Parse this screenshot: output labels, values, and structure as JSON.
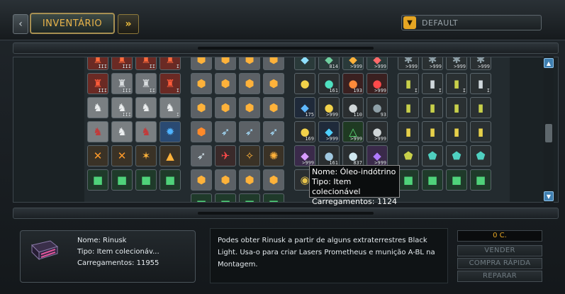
{
  "header": {
    "inventory_tab": "INVENTÁRIO",
    "nav_prev": "‹",
    "nav_next": "»",
    "filter": {
      "value": "DEFAULT"
    }
  },
  "grid": {
    "columns": [
      {
        "rows": [
          [
            {
              "icon": "red-drone-icon",
              "bg": "#6a2a24",
              "fg": "#ff6a3c",
              "qty": "III"
            },
            {
              "icon": "red-drone-icon",
              "bg": "#6a2a24",
              "fg": "#ff6a3c",
              "qty": "III"
            },
            {
              "icon": "red-drone-icon",
              "bg": "#6a2a24",
              "fg": "#ff6a3c",
              "qty": "II"
            },
            {
              "icon": "red-drone-icon",
              "bg": "#6a2a24",
              "fg": "#ff6a3c",
              "qty": "I"
            }
          ],
          [
            {
              "icon": "red-drone-icon",
              "bg": "#6a2a24",
              "fg": "#ff5b3a",
              "qty": "III"
            },
            {
              "icon": "grey-drone-icon",
              "bg": "#6f7478",
              "fg": "#d8dcde",
              "qty": "III"
            },
            {
              "icon": "grey-drone-icon",
              "bg": "#6f7478",
              "fg": "#d8dcde",
              "qty": "II"
            },
            {
              "icon": "red-drone-icon",
              "bg": "#6a2a24",
              "fg": "#ff5b3a",
              "qty": "I"
            }
          ],
          [
            {
              "icon": "grey-mech-icon",
              "bg": "#7a7f82",
              "fg": "#eceff0",
              "qty": ""
            },
            {
              "icon": "grey-mech-icon",
              "bg": "#7a7f82",
              "fg": "#eceff0",
              "qty": "III"
            },
            {
              "icon": "grey-mech-icon",
              "bg": "#7a7f82",
              "fg": "#eceff0",
              "qty": ""
            },
            {
              "icon": "grey-mech-icon",
              "bg": "#7a7f82",
              "fg": "#eceff0",
              "qty": "I"
            }
          ],
          [
            {
              "icon": "red-mech-icon",
              "bg": "#7a7f82",
              "fg": "#c23a3a",
              "qty": ""
            },
            {
              "icon": "grey-mech-icon",
              "bg": "#7a7f82",
              "fg": "#eceff0",
              "qty": ""
            },
            {
              "icon": "red-mech-icon",
              "bg": "#7a7f82",
              "fg": "#c23a3a",
              "qty": ""
            },
            {
              "icon": "blue-gear-icon",
              "bg": "#2a4a72",
              "fg": "#4fb3ff",
              "qty": ""
            }
          ],
          [
            {
              "icon": "orange-tool-icon",
              "bg": "#3a3226",
              "fg": "#ff9a2a",
              "qty": ""
            },
            {
              "icon": "orange-tool-icon",
              "bg": "#3a3226",
              "fg": "#ff9a2a",
              "qty": ""
            },
            {
              "icon": "orange-star-icon",
              "bg": "#3a3226",
              "fg": "#ffb23a",
              "qty": ""
            },
            {
              "icon": "orange-triangle-icon",
              "bg": "#3a3226",
              "fg": "#ffb23a",
              "qty": ""
            }
          ],
          [
            {
              "icon": "green-module-icon",
              "bg": "#1f3a2a",
              "fg": "#4fd27a",
              "qty": ""
            },
            {
              "icon": "green-module-icon",
              "bg": "#1f3a2a",
              "fg": "#4fd27a",
              "qty": ""
            },
            {
              "icon": "green-module-icon",
              "bg": "#1f3a2a",
              "fg": "#4fd27a",
              "qty": ""
            },
            {
              "icon": "green-module-icon",
              "bg": "#1f3a2a",
              "fg": "#4fd27a",
              "qty": ""
            }
          ]
        ]
      },
      {
        "rows": [
          [
            {
              "icon": "orange-hex-icon",
              "bg": "#5c6166",
              "fg": "#ffb23a",
              "qty": ""
            },
            {
              "icon": "orange-hex-icon",
              "bg": "#5c6166",
              "fg": "#ffb23a",
              "qty": ""
            },
            {
              "icon": "orange-hex-icon",
              "bg": "#5c6166",
              "fg": "#ffb23a",
              "qty": ""
            },
            {
              "icon": "orange-hex-icon",
              "bg": "#5c6166",
              "fg": "#ffb23a",
              "qty": ""
            }
          ],
          [
            {
              "icon": "orange-hex-icon",
              "bg": "#5c6166",
              "fg": "#ffb23a",
              "qty": ""
            },
            {
              "icon": "orange-hex-icon",
              "bg": "#5c6166",
              "fg": "#ffb23a",
              "qty": ""
            },
            {
              "icon": "orange-hex-icon",
              "bg": "#5c6166",
              "fg": "#ffb23a",
              "qty": ""
            },
            {
              "icon": "orange-hex-icon",
              "bg": "#5c6166",
              "fg": "#ffb23a",
              "qty": ""
            }
          ],
          [
            {
              "icon": "orange-hex-icon",
              "bg": "#5c6166",
              "fg": "#ffb23a",
              "qty": ""
            },
            {
              "icon": "orange-hex-icon",
              "bg": "#5c6166",
              "fg": "#ffb23a",
              "qty": ""
            },
            {
              "icon": "orange-hex-icon",
              "bg": "#5c6166",
              "fg": "#ffb23a",
              "qty": ""
            },
            {
              "icon": "orange-hex-icon",
              "bg": "#5c6166",
              "fg": "#ffb23a",
              "qty": ""
            }
          ],
          [
            {
              "icon": "orange-hex-icon",
              "bg": "#5c6166",
              "fg": "#ff8a2a",
              "qty": ""
            },
            {
              "icon": "missile-icon",
              "bg": "#5c6166",
              "fg": "#a7e0ff",
              "qty": ""
            },
            {
              "icon": "missile-icon",
              "bg": "#5c6166",
              "fg": "#a7e0ff",
              "qty": ""
            },
            {
              "icon": "missile-icon",
              "bg": "#5c6166",
              "fg": "#a7e0ff",
              "qty": ""
            }
          ],
          [
            {
              "icon": "missile-icon",
              "bg": "#5c6166",
              "fg": "#d7e8f0",
              "qty": ""
            },
            {
              "icon": "red-ship-icon",
              "bg": "#3a2a2a",
              "fg": "#ff4a4a",
              "qty": ""
            },
            {
              "icon": "wrench-icon",
              "bg": "#3a3226",
              "fg": "#ffb23a",
              "qty": ""
            },
            {
              "icon": "cog-icon",
              "bg": "#3a3226",
              "fg": "#ffb23a",
              "qty": ""
            }
          ],
          [
            {
              "icon": "orange-hex-icon",
              "bg": "#5c6166",
              "fg": "#ffb23a",
              "qty": ""
            },
            {
              "icon": "orange-hex-icon",
              "bg": "#5c6166",
              "fg": "#ffb23a",
              "qty": ""
            },
            {
              "icon": "orange-hex-icon",
              "bg": "#5c6166",
              "fg": "#ffb23a",
              "qty": ""
            },
            {
              "icon": "orange-hex-icon",
              "bg": "#5c6166",
              "fg": "#ffb23a",
              "qty": ""
            }
          ],
          [
            {
              "icon": "green-module-icon",
              "bg": "#1f3a2a",
              "fg": "#4fd27a",
              "qty": ""
            },
            {
              "icon": "green-module-icon",
              "bg": "#1f3a2a",
              "fg": "#4fd27a",
              "qty": ""
            },
            {
              "icon": "green-module-icon",
              "bg": "#1f3a2a",
              "fg": "#4fd27a",
              "qty": ""
            },
            {
              "icon": "green-module-icon",
              "bg": "#1f3a2a",
              "fg": "#4fd27a",
              "qty": ""
            }
          ]
        ]
      },
      {
        "rows": [
          [
            {
              "icon": "crystal-icon",
              "bg": "#2a3a3a",
              "fg": "#8fe0ff",
              "qty": ""
            },
            {
              "icon": "crystal-icon",
              "bg": "#2a3a3a",
              "fg": "#6fd0a0",
              "qty": "814"
            },
            {
              "icon": "crystal-icon",
              "bg": "#2a3a3a",
              "fg": "#ffb23a",
              "qty": ">999"
            },
            {
              "icon": "crystal-icon",
              "bg": "#2a3a3a",
              "fg": "#ff6a6a",
              "qty": ">999"
            }
          ],
          [
            {
              "icon": "ore-icon",
              "bg": "#2a2e30",
              "fg": "#f2d24a",
              "qty": ""
            },
            {
              "icon": "ore-icon",
              "bg": "#2a2e30",
              "fg": "#4fe0c0",
              "qty": "161"
            },
            {
              "icon": "ore-icon",
              "bg": "#3a2020",
              "fg": "#ff8a3a",
              "qty": "193"
            },
            {
              "icon": "ore-icon",
              "bg": "#3a2020",
              "fg": "#ff4a4a",
              "qty": ">999"
            }
          ],
          [
            {
              "icon": "crystal-icon",
              "bg": "#1f2a3a",
              "fg": "#5fb8ff",
              "qty": "175"
            },
            {
              "icon": "ore-icon",
              "bg": "#2a2e30",
              "fg": "#f2d24a",
              "qty": ">999"
            },
            {
              "icon": "ore-icon",
              "bg": "#2a2e30",
              "fg": "#d0d6d8",
              "qty": "110"
            },
            {
              "icon": "ore-icon",
              "bg": "#2a2e30",
              "fg": "#8fa0a8",
              "qty": "93"
            }
          ],
          [
            {
              "icon": "ore-icon",
              "bg": "#2a2e30",
              "fg": "#f2d24a",
              "qty": "169"
            },
            {
              "icon": "crystal-icon",
              "bg": "#1f2a3a",
              "fg": "#4fd0ff",
              "qty": ">999"
            },
            {
              "icon": "triangle-icon",
              "bg": "#1f3a22",
              "fg": "#5fe07a",
              "qty": ">999"
            },
            {
              "icon": "ore-icon",
              "bg": "#2a2e30",
              "fg": "#d0d6d8",
              "qty": ">999"
            }
          ],
          [
            {
              "icon": "crystal-icon",
              "bg": "#3a2a4a",
              "fg": "#d79aff",
              "qty": ">999"
            },
            {
              "icon": "ore-icon",
              "bg": "#2a2e30",
              "fg": "#a0c8e0",
              "qty": "161"
            },
            {
              "icon": "ore-icon",
              "bg": "#2a2e30",
              "fg": "#d0e8f0",
              "qty": "837"
            },
            {
              "icon": "crystal-icon",
              "bg": "#3a2a4a",
              "fg": "#b07aff",
              "qty": ">999"
            }
          ],
          [
            {
              "icon": "coin-icon",
              "bg": "#2a2e30",
              "fg": "#e6c24a",
              "qty": ""
            },
            {
              "icon": "coin-icon",
              "bg": "#2a2e30",
              "fg": "#e6c24a",
              "qty": ""
            },
            {
              "icon": "coin-icon",
              "bg": "#2a2e30",
              "fg": "#e6c24a",
              "qty": ""
            },
            {
              "icon": "coin-icon",
              "bg": "#2a2e30",
              "fg": "#e6c24a",
              "qty": ""
            }
          ]
        ]
      },
      {
        "rows": [
          [
            {
              "icon": "gear-module-icon",
              "bg": "#2a3032",
              "fg": "#8fa0a8",
              "qty": ">999"
            },
            {
              "icon": "gear-module-icon",
              "bg": "#2a3032",
              "fg": "#8fa0a8",
              "qty": ">999"
            },
            {
              "icon": "gear-module-icon",
              "bg": "#2a3032",
              "fg": "#8fa0a8",
              "qty": ">999"
            },
            {
              "icon": "gear-module-icon",
              "bg": "#2a3032",
              "fg": "#8fa0a8",
              "qty": ">999"
            }
          ],
          [
            {
              "icon": "cannon-icon",
              "bg": "#2a3032",
              "fg": "#c8d04a",
              "qty": "I"
            },
            {
              "icon": "cannon-icon",
              "bg": "#2a3032",
              "fg": "#d0d8dc",
              "qty": "I"
            },
            {
              "icon": "cannon-icon",
              "bg": "#2a3032",
              "fg": "#c8d04a",
              "qty": "I"
            },
            {
              "icon": "cannon-icon",
              "bg": "#2a3032",
              "fg": "#d0d8dc",
              "qty": "I"
            }
          ],
          [
            {
              "icon": "cannon-icon",
              "bg": "#2a3032",
              "fg": "#c8d04a",
              "qty": ""
            },
            {
              "icon": "cannon-icon",
              "bg": "#2a3032",
              "fg": "#c8d04a",
              "qty": ""
            },
            {
              "icon": "cannon-icon",
              "bg": "#2a3032",
              "fg": "#c8d04a",
              "qty": ""
            },
            {
              "icon": "cannon-icon",
              "bg": "#2a3032",
              "fg": "#c8d04a",
              "qty": ""
            }
          ],
          [
            {
              "icon": "cannon-icon",
              "bg": "#2a3032",
              "fg": "#e6d04a",
              "qty": ""
            },
            {
              "icon": "cannon-icon",
              "bg": "#2a3032",
              "fg": "#e6d04a",
              "qty": ""
            },
            {
              "icon": "cannon-icon",
              "bg": "#2a3032",
              "fg": "#e6d04a",
              "qty": ""
            },
            {
              "icon": "cannon-icon",
              "bg": "#2a3032",
              "fg": "#e6d04a",
              "qty": ""
            }
          ],
          [
            {
              "icon": "shield-module-icon",
              "bg": "#2a3032",
              "fg": "#c8d04a",
              "qty": ""
            },
            {
              "icon": "shield-module-icon",
              "bg": "#2a3032",
              "fg": "#4fd0c0",
              "qty": ""
            },
            {
              "icon": "shield-module-icon",
              "bg": "#2a3032",
              "fg": "#4fd0c0",
              "qty": ""
            },
            {
              "icon": "shield-module-icon",
              "bg": "#2a3032",
              "fg": "#4fd0c0",
              "qty": ""
            }
          ],
          [
            {
              "icon": "green-module-icon",
              "bg": "#1f3a2a",
              "fg": "#4fd27a",
              "qty": ""
            },
            {
              "icon": "green-module-icon",
              "bg": "#1f3a2a",
              "fg": "#4fd27a",
              "qty": ""
            },
            {
              "icon": "green-module-icon",
              "bg": "#1f3a2a",
              "fg": "#4fd27a",
              "qty": ""
            },
            {
              "icon": "green-module-icon",
              "bg": "#1f3a2a",
              "fg": "#4fd27a",
              "qty": ""
            }
          ]
        ]
      }
    ]
  },
  "tooltip": {
    "name": "Nome: Óleo-indótrino",
    "type": "Tipo: Item colecionável",
    "loads": "Carregamentos: 1124"
  },
  "selected_item": {
    "icon": "rinusk-item-icon",
    "name": "Nome: Rinusk",
    "type": "Tipo: Item colecionáv...",
    "loads": "Carregamentos: 11955",
    "description": "Podes obter Rinusk a partir de alguns extraterrestres Black Light. Usa-o para criar Lasers Prometheus e munição A-BL na Montagem."
  },
  "actions": {
    "credits": "0 C.",
    "sell": "VENDER",
    "quick_buy": "COMPRA RÁPIDA",
    "repair": "REPARAR"
  },
  "colors": {
    "accent": "#e6a623",
    "tooltip_bg": "#0b0d0e"
  }
}
